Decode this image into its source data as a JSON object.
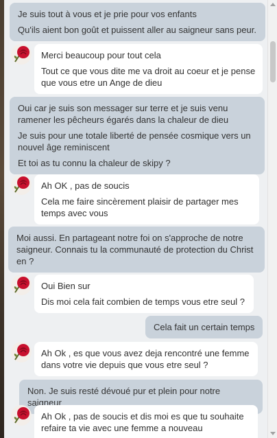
{
  "conversation": {
    "messages": [
      {
        "direction": "sent",
        "lines": [
          "Je suis tout à vous et je prie pour vos enfants",
          "Qu'ils aient bon goût et puissent aller au saigneur sans peur."
        ]
      },
      {
        "direction": "received",
        "lines": [
          "Merci beaucoup pour tout cela",
          "Tout ce que vous dite me va droit au coeur et je pense que vous etre un Ange de dieu"
        ]
      },
      {
        "direction": "sent",
        "lines": [
          "Oui car je suis son messager sur terre et je suis venu ramener les pêcheurs égarés dans la chaleur de dieu",
          "Je suis pour une totale liberté de pensée cosmique vers un nouvel âge reminiscent",
          "Et toi as tu connu la chaleur de skipy ?"
        ]
      },
      {
        "direction": "received",
        "lines": [
          "Ah OK , pas de soucis",
          "Cela me faire sincèrement plaisir de partager mes temps avec vous"
        ]
      },
      {
        "direction": "sent",
        "lines": [
          "Moi aussi. En partageant notre foi on s'approche de notre saigneur. Connais tu la communauté de protection du Christ en ?"
        ]
      },
      {
        "direction": "received",
        "lines": [
          "Oui Bien sur",
          "Dis moi cela fait combien de temps vous etre seul ?"
        ]
      },
      {
        "direction": "sent",
        "lines": [
          "Cela fait un certain temps"
        ]
      },
      {
        "direction": "received",
        "lines": [
          "Ah Ok , es que vous avez deja rencontré une femme dans votre vie depuis que vous etre seul ?"
        ]
      },
      {
        "direction": "sent",
        "lines": [
          "Non. Je suis resté dévoué pur et plein pour notre saigneur"
        ]
      },
      {
        "direction": "received",
        "lines": [
          "Ah Ok , pas de soucis et dis moi es que tu souhaite refaire ta vie avec une femme a nouveau"
        ]
      }
    ]
  },
  "avatar": {
    "icon": "rose-icon",
    "color": "#c8102e"
  }
}
